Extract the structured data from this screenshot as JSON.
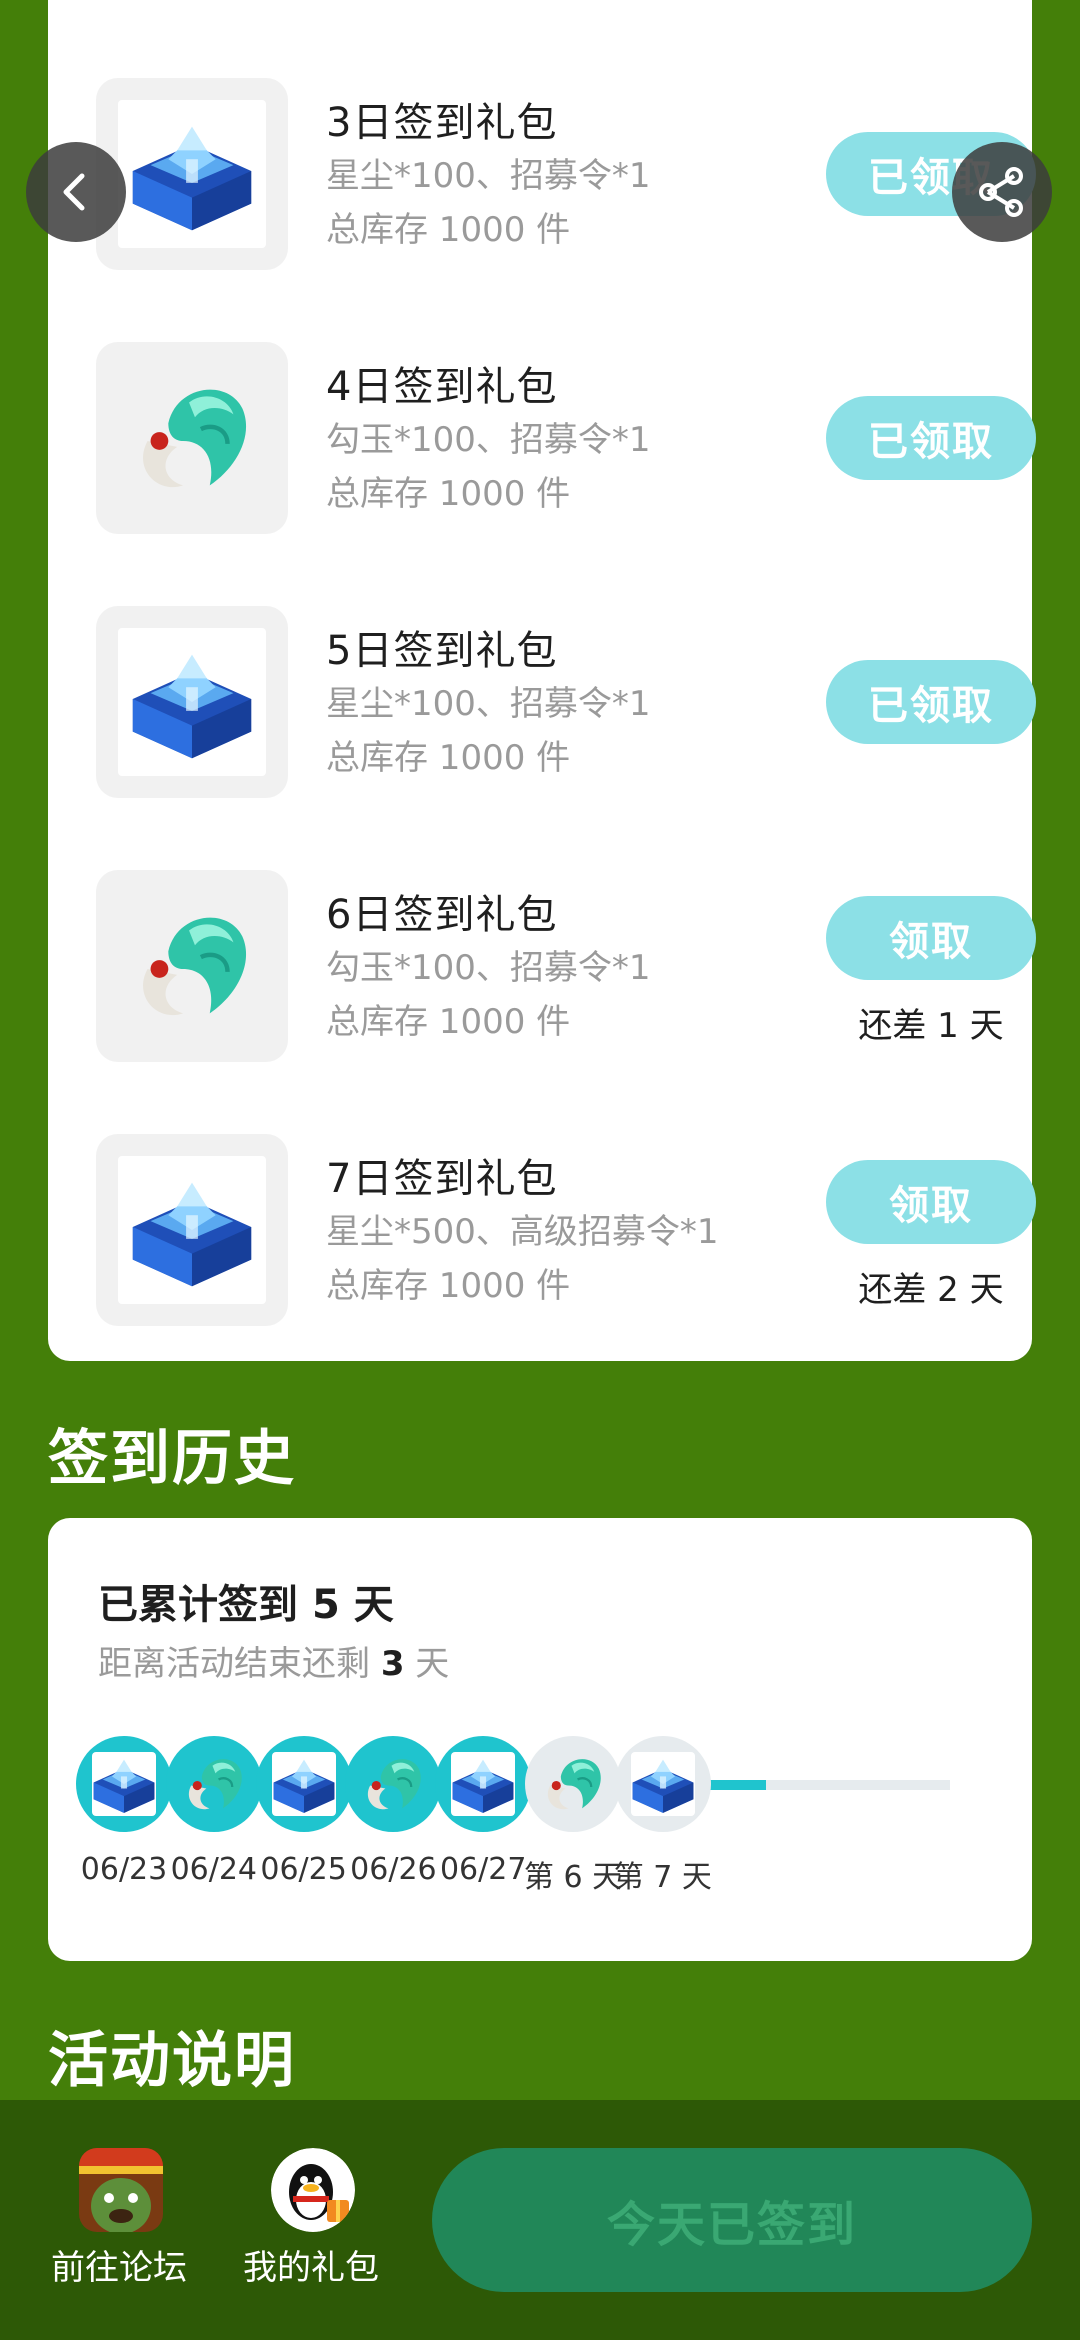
{
  "gifts": [
    {
      "title": "3日签到礼包",
      "content": "星尘*100、招募令*1",
      "stock": "总库存 1000 件",
      "button": "已领取",
      "remaining": "",
      "icon": "star-dust-chest-icon"
    },
    {
      "title": "4日签到礼包",
      "content": "勾玉*100、招募令*1",
      "stock": "总库存 1000 件",
      "button": "已领取",
      "remaining": "",
      "icon": "magatama-icon"
    },
    {
      "title": "5日签到礼包",
      "content": "星尘*100、招募令*1",
      "stock": "总库存 1000 件",
      "button": "已领取",
      "remaining": "",
      "icon": "star-dust-chest-icon"
    },
    {
      "title": "6日签到礼包",
      "content": "勾玉*100、招募令*1",
      "stock": "总库存 1000 件",
      "button": "领取",
      "remaining": "还差 1 天",
      "icon": "magatama-icon"
    },
    {
      "title": "7日签到礼包",
      "content": "星尘*500、高级招募令*1",
      "stock": "总库存 1000 件",
      "button": "领取",
      "remaining": "还差 2 天",
      "icon": "star-dust-chest-icon"
    }
  ],
  "history": {
    "section_title": "签到历史",
    "total_prefix": "已累计签到 ",
    "total_days": "5",
    "total_suffix": " 天",
    "remaining_prefix": "距离活动结束还剩 ",
    "remaining_days": "3",
    "remaining_suffix": " 天",
    "days": [
      {
        "label": "06/23",
        "status": "done",
        "icon": "star-dust-chest-icon"
      },
      {
        "label": "06/24",
        "status": "done",
        "icon": "magatama-icon"
      },
      {
        "label": "06/25",
        "status": "done",
        "icon": "star-dust-chest-icon"
      },
      {
        "label": "06/26",
        "status": "done",
        "icon": "magatama-icon"
      },
      {
        "label": "06/27",
        "status": "done",
        "icon": "star-dust-chest-icon"
      },
      {
        "label": "第 6 天",
        "status": "pending",
        "icon": "magatama-icon"
      },
      {
        "label": "第 7 天",
        "status": "pending",
        "icon": "star-dust-chest-icon"
      }
    ]
  },
  "rules": {
    "section_title": "活动说明"
  },
  "bottom_bar": {
    "forum_label": "前往论坛",
    "gifts_label": "我的礼包",
    "checkin_button": "今天已签到"
  },
  "colors": {
    "background": "#447f09",
    "claim_button": "#8ce0e6",
    "timeline_done": "#1fc4ce",
    "timeline_pending": "#e6ebee",
    "checkin_button": "#218758"
  }
}
